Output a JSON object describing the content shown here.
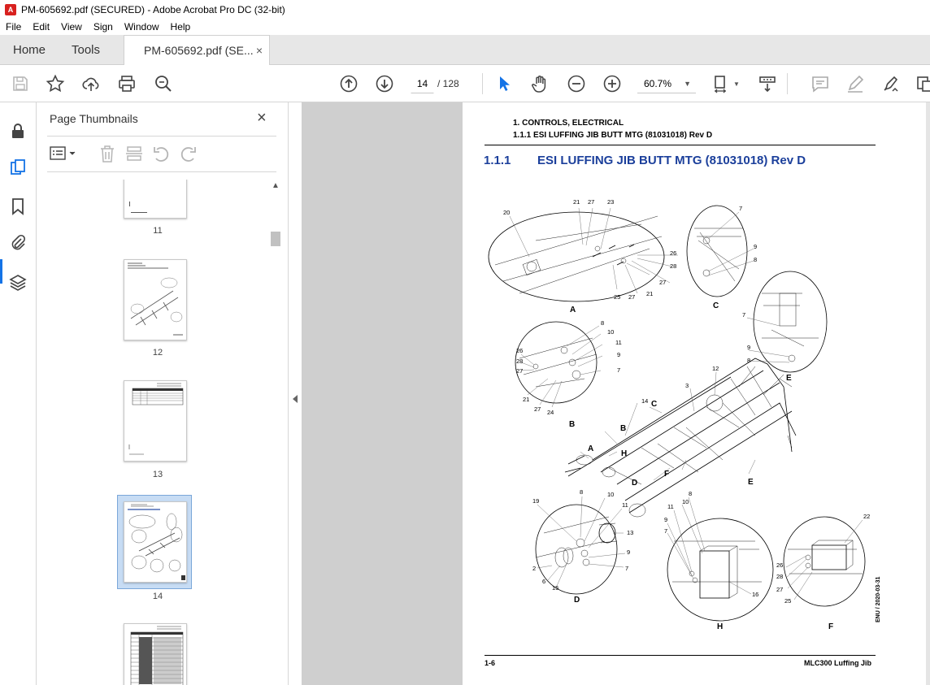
{
  "window": {
    "title": "PM-605692.pdf (SECURED) - Adobe Acrobat Pro DC (32-bit)",
    "app_icon": "A"
  },
  "menu": [
    "File",
    "Edit",
    "View",
    "Sign",
    "Window",
    "Help"
  ],
  "tabs": {
    "home": "Home",
    "tools": "Tools",
    "document": "PM-605692.pdf (SE...",
    "close": "×"
  },
  "toolbar": {
    "page_current": "14",
    "page_total": "/ 128",
    "zoom": "60.7%"
  },
  "thumb_panel": {
    "title": "Page Thumbnails",
    "close": "×",
    "pages": [
      {
        "label": "11"
      },
      {
        "label": "12"
      },
      {
        "label": "13"
      },
      {
        "label": "14"
      },
      {
        "label": ""
      }
    ]
  },
  "page": {
    "header_line1": "1. CONTROLS, ELECTRICAL",
    "header_line2": "1.1.1 ESI LUFFING JIB BUTT MTG (81031018) Rev D",
    "section_number": "1.1.1",
    "section_title": "ESI LUFFING JIB BUTT MTG (81031018) Rev D",
    "footer_left": "1-6",
    "footer_right": "MLC300 Luffing Jib",
    "side_date": "ENU / 2020-03-31",
    "detail_labels": {
      "A": "A",
      "B": "B",
      "C": "C",
      "D": "D",
      "E": "E",
      "F": "F",
      "H": "H"
    },
    "callouts": {
      "a": [
        "20",
        "21",
        "27",
        "23",
        "26",
        "28",
        "27",
        "21",
        "25",
        "27"
      ],
      "c": [
        "7",
        "9",
        "8"
      ],
      "e": [
        "7",
        "9",
        "8"
      ],
      "b": [
        "8",
        "10",
        "11",
        "9",
        "7",
        "26",
        "28",
        "27",
        "21",
        "27",
        "24"
      ],
      "main": [
        "12",
        "3",
        "14",
        "C",
        "B",
        "A",
        "H",
        "D",
        "F",
        "E"
      ],
      "d": [
        "8",
        "10",
        "11",
        "19",
        "13",
        "9",
        "2",
        "6",
        "15",
        "7"
      ],
      "h": [
        "10",
        "8",
        "11",
        "9",
        "7",
        "16"
      ],
      "f": [
        "22",
        "26",
        "28",
        "27",
        "25"
      ]
    }
  }
}
